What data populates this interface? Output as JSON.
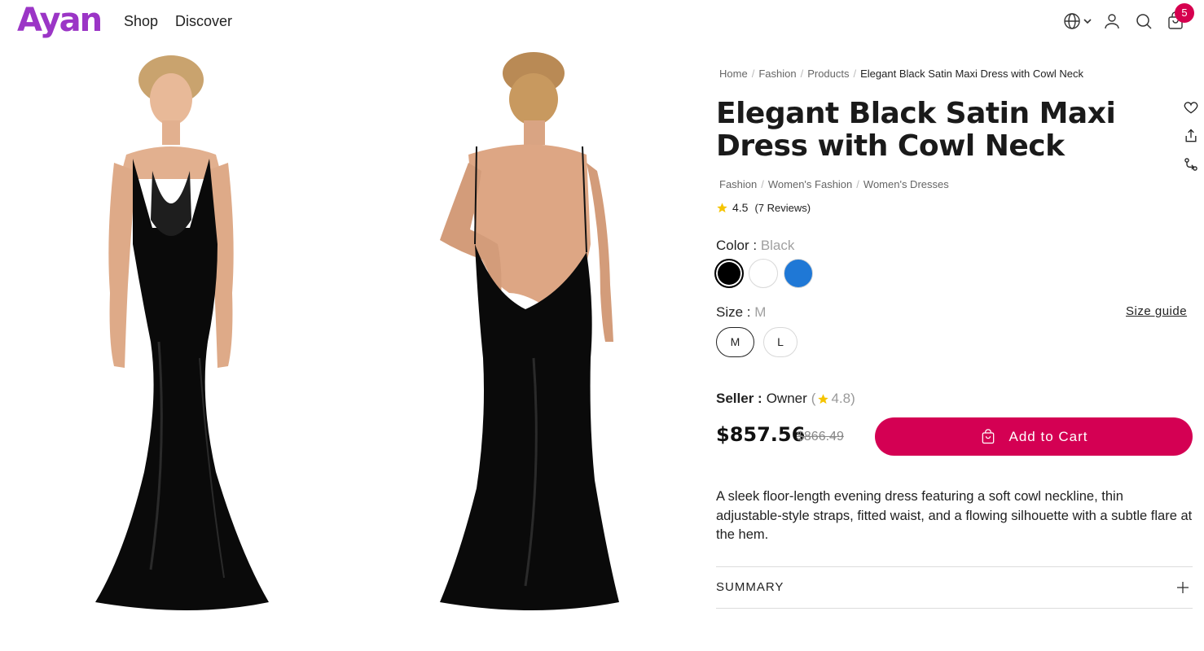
{
  "header": {
    "logo": "Ayan",
    "nav": {
      "shop": "Shop",
      "discover": "Discover"
    },
    "icons": [
      "globe-icon",
      "chevron-down-icon",
      "user-icon",
      "search-icon",
      "cart-icon"
    ],
    "cart_count": "5"
  },
  "gallery": {
    "images": [
      "dress-front-image",
      "dress-back-image"
    ]
  },
  "breadcrumb": {
    "items": [
      "Home",
      "Fashion",
      "Products"
    ],
    "current": "Elegant Black Satin Maxi Dress with Cowl Neck"
  },
  "product": {
    "title": "Elegant Black Satin Maxi Dress with Cowl Neck",
    "categories": [
      "Fashion",
      "Women's Fashion",
      "Women's Dresses"
    ],
    "rating": "4.5",
    "reviews": "(7 Reviews)",
    "color_label": "Color :",
    "color_value": "Black",
    "colors": [
      "#000000",
      "#ffffff",
      "#1f78d6"
    ],
    "size_label": "Size :",
    "size_value": "M",
    "size_guide": "Size guide",
    "sizes": [
      "M",
      "L"
    ],
    "seller_label": "Seller :",
    "seller_name": "Owner",
    "seller_rating_open": "(",
    "seller_rating": "4.8)",
    "price": "$857.56",
    "old_price": "$866.49",
    "add_to_cart": "Add to Cart",
    "description": "A sleek floor-length evening dress featuring a soft cowl neckline, thin adjustable-style straps, fitted waist, and a flowing silhouette with a subtle flare at the hem.",
    "summary_label": "SUMMARY",
    "accent": "#d40053",
    "brand": "#9b35c6"
  }
}
